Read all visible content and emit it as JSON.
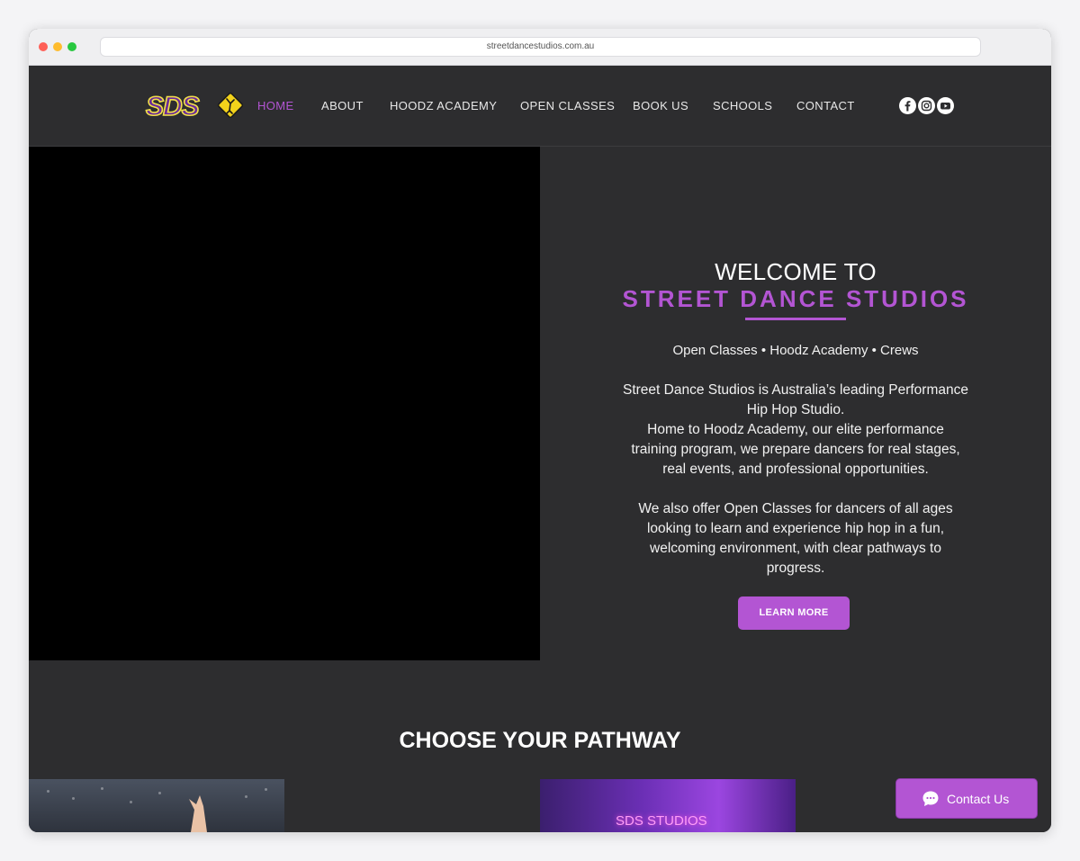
{
  "browser": {
    "url": "streetdancestudios.com.au"
  },
  "nav": {
    "logo_text": "SDS",
    "items": [
      {
        "label": "HOME",
        "active": true
      },
      {
        "label": "ABOUT",
        "active": false
      },
      {
        "label": "HOODZ ACADEMY",
        "active": false
      },
      {
        "label": "OPEN CLASSES",
        "active": false
      },
      {
        "label": "BOOK US",
        "active": false
      },
      {
        "label": "SCHOOLS",
        "active": false
      },
      {
        "label": "CONTACT",
        "active": false
      }
    ],
    "social": [
      "facebook-icon",
      "instagram-icon",
      "youtube-icon"
    ]
  },
  "hero": {
    "welcome": "WELCOME TO",
    "studio_name": "STREET DANCE STUDIOS",
    "tagline": "Open Classes • Hoodz Academy • Crews",
    "paragraph1": "Street Dance Studios is Australia’s leading Performance Hip Hop Studio.",
    "paragraph2": "Home to Hoodz Academy, our elite performance training program, we prepare dancers for real stages, real events, and professional opportunities.",
    "paragraph3": "We also offer Open Classes for dancers of all ages looking to learn and experience hip hop in a fun, welcoming environment, with clear pathways to progress.",
    "button_label": "LEARN MORE"
  },
  "pathway": {
    "title": "CHOOSE YOUR PATHWAY",
    "right_image_sign": "SDS STUDIOS"
  },
  "chat": {
    "label": "Contact Us"
  },
  "colors": {
    "accent": "#b355d3",
    "background": "#2d2d2f"
  }
}
